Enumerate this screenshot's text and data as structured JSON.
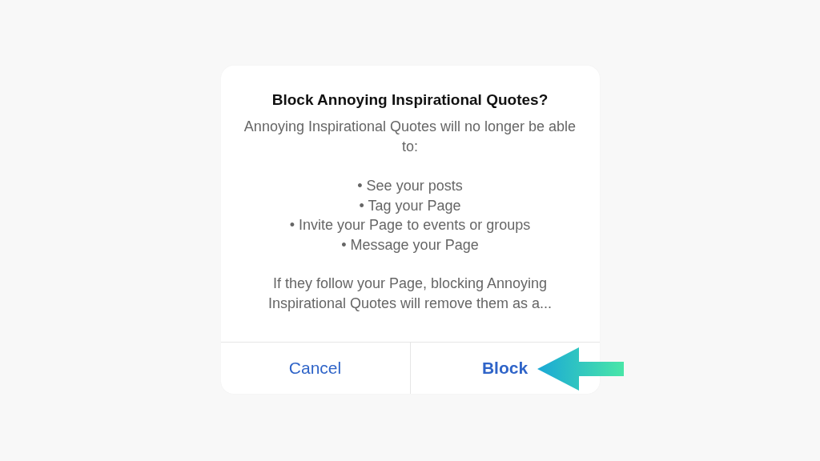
{
  "dialog": {
    "title": "Block Annoying Inspirational Quotes?",
    "message": "Annoying Inspirational Quotes will no longer be able to:",
    "restrictions": [
      "• See your posts",
      "• Tag your Page",
      "• Invite your Page to events or groups",
      "• Message your Page"
    ],
    "note": "If they follow your Page, blocking Annoying Inspirational Quotes will remove them as a...",
    "buttons": [
      {
        "label": "Cancel",
        "preferred": false,
        "highlighted": false
      },
      {
        "label": "Block",
        "preferred": true,
        "highlighted": true
      }
    ]
  }
}
